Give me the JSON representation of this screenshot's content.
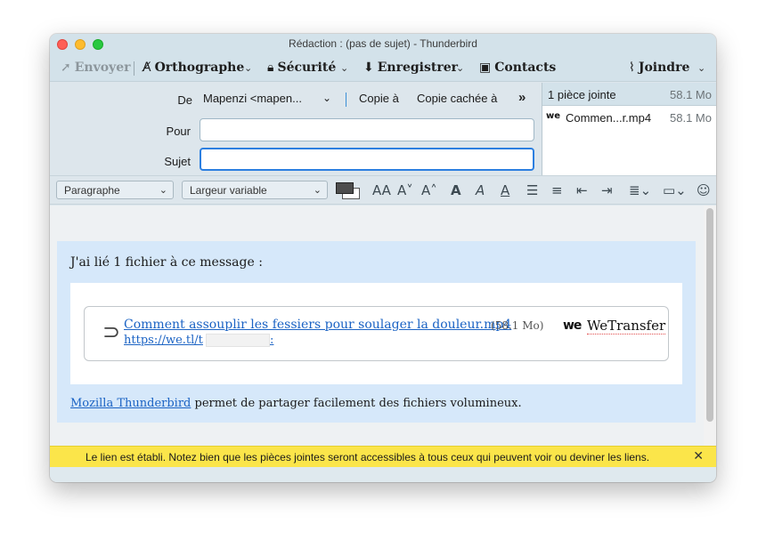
{
  "window": {
    "title": "Rédaction : (pas de sujet) - Thunderbird"
  },
  "toolbar": {
    "send": "Envoyer",
    "spelling": "Orthographe",
    "security": "Sécurité",
    "save": "Enregistrer",
    "contacts": "Contacts",
    "attach": "Joindre"
  },
  "header": {
    "from_label": "De",
    "from_value": "Mapenzi <mapen...",
    "cc_label": "Copie à",
    "bcc_label": "Copie cachée à",
    "to_label": "Pour",
    "to_value": "",
    "subject_label": "Sujet",
    "subject_value": ""
  },
  "attachments": {
    "count_label": "1 pièce jointe",
    "total_size": "58.1 Mo",
    "items": [
      {
        "name": "Commen...r.mp4",
        "size": "58.1 Mo",
        "icon": "wetransfer-icon"
      }
    ]
  },
  "format": {
    "paragraph": "Paragraphe",
    "font": "Largeur variable"
  },
  "body": {
    "intro": "J'ai lié 1 fichier à ce message :",
    "file_name": "Comment assouplir les fessiers pour soulager la douleur.mp4",
    "file_size": "(58.1 Mo)",
    "url_prefix": "https://we.tl/t",
    "url_suffix": ":",
    "provider_logo": "we",
    "provider_name": "WeTransfer",
    "footer_link": "Mozilla Thunderbird",
    "footer_text": " permet de partager facilement des fichiers volumineux."
  },
  "notification": {
    "text": "Le lien est établi. Notez bien que les pièces jointes seront accessibles à tous ceux qui peuvent voir ou deviner les liens.",
    "close": "✕"
  },
  "colors": {
    "accent": "#2c7fe0",
    "link": "#1b63c4",
    "notify": "#fbe54a"
  }
}
